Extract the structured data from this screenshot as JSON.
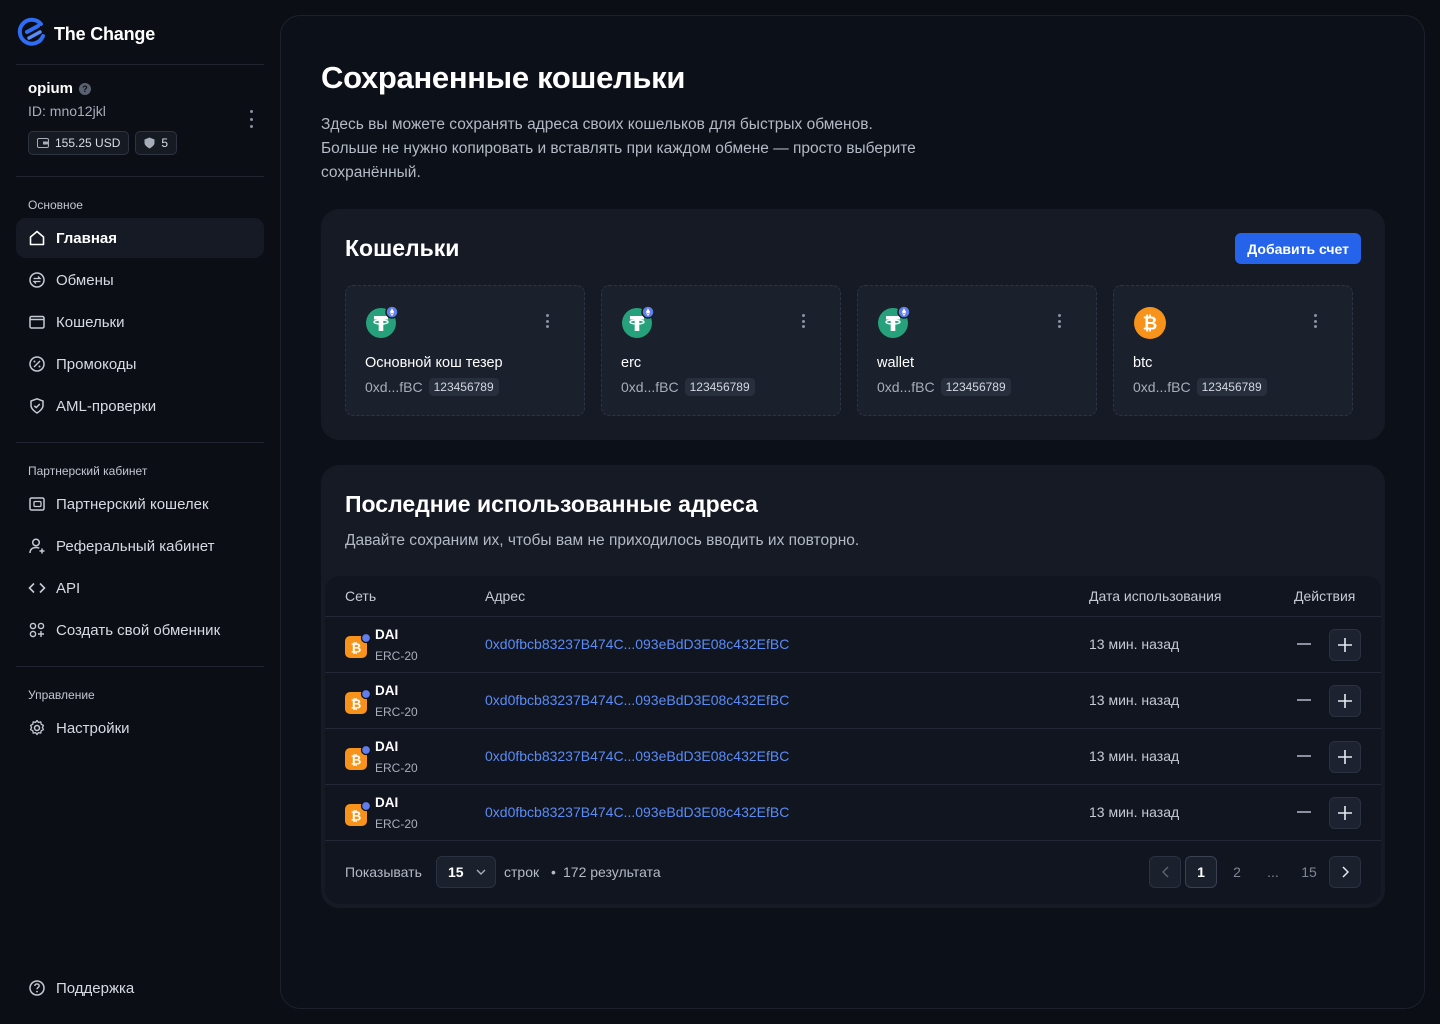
{
  "brand": {
    "name": "The Change",
    "accent": "#2563eb"
  },
  "user": {
    "name": "opium",
    "id": "ID: mno12jkl",
    "balance": "155.25 USD",
    "level": "5"
  },
  "sidebar": {
    "sections": [
      {
        "title": "Основное"
      },
      {
        "title": "Партнерский кабинет"
      },
      {
        "title": "Управление"
      }
    ],
    "items": [
      {
        "label": "Главная",
        "icon": "home-icon",
        "active": true
      },
      {
        "label": "Обмены",
        "icon": "exchange-icon"
      },
      {
        "label": "Кошельки",
        "icon": "wallet-icon"
      },
      {
        "label": "Промокоды",
        "icon": "promo-icon"
      },
      {
        "label": "AML-проверки",
        "icon": "shield-check-icon"
      },
      {
        "label": "Партнерский кошелек",
        "icon": "partner-wallet-icon"
      },
      {
        "label": "Реферальный кабинет",
        "icon": "user-plus-icon"
      },
      {
        "label": "API",
        "icon": "code-icon"
      },
      {
        "label": "Создать свой обменник",
        "icon": "grid-plus-icon"
      },
      {
        "label": "Настройки",
        "icon": "gear-icon"
      }
    ],
    "support": "Поддержка"
  },
  "page": {
    "title": "Сохраненные кошельки",
    "description": "Здесь вы можете сохранять адреса своих кошельков для быстрых обменов. Больше не нужно копировать и вставлять при каждом обмене — просто выберите сохранённый."
  },
  "wallets": {
    "title": "Кошельки",
    "add_label": "Добавить счет",
    "items": [
      {
        "name": "Основной кош тезер",
        "address": "0xd...fBC",
        "tag": "123456789",
        "coin": "tether-icon"
      },
      {
        "name": "erc",
        "address": "0xd...fBC",
        "tag": "123456789",
        "coin": "tether-icon"
      },
      {
        "name": "wallet",
        "address": "0xd...fBC",
        "tag": "123456789",
        "coin": "tether-icon"
      },
      {
        "name": "btc",
        "address": "0xd...fBC",
        "tag": "123456789",
        "coin": "bitcoin-icon"
      }
    ]
  },
  "recent": {
    "title": "Последние использованные адреса",
    "description": "Давайте сохраним их, чтобы вам не приходилось вводить их повторно.",
    "columns": [
      "Сеть",
      "Адрес",
      "Дата использования",
      "Действия"
    ],
    "rows": [
      {
        "coin": "DAI",
        "network": "ERC-20",
        "address": "0xd0fbcb83237B474C...093eBdD3E08c432EfBC",
        "date": "13 мин. назад"
      },
      {
        "coin": "DAI",
        "network": "ERC-20",
        "address": "0xd0fbcb83237B474C...093eBdD3E08c432EfBC",
        "date": "13 мин. назад"
      },
      {
        "coin": "DAI",
        "network": "ERC-20",
        "address": "0xd0fbcb83237B474C...093eBdD3E08c432EfBC",
        "date": "13 мин. назад"
      },
      {
        "coin": "DAI",
        "network": "ERC-20",
        "address": "0xd0fbcb83237B474C...093eBdD3E08c432EfBC",
        "date": "13 мин. назад"
      }
    ],
    "footer": {
      "show_label": "Показывать",
      "page_size": "15",
      "rows_label": "строк",
      "results": "172 результата",
      "pages": [
        "1",
        "2",
        "...",
        "15"
      ],
      "current_page": "1"
    }
  }
}
